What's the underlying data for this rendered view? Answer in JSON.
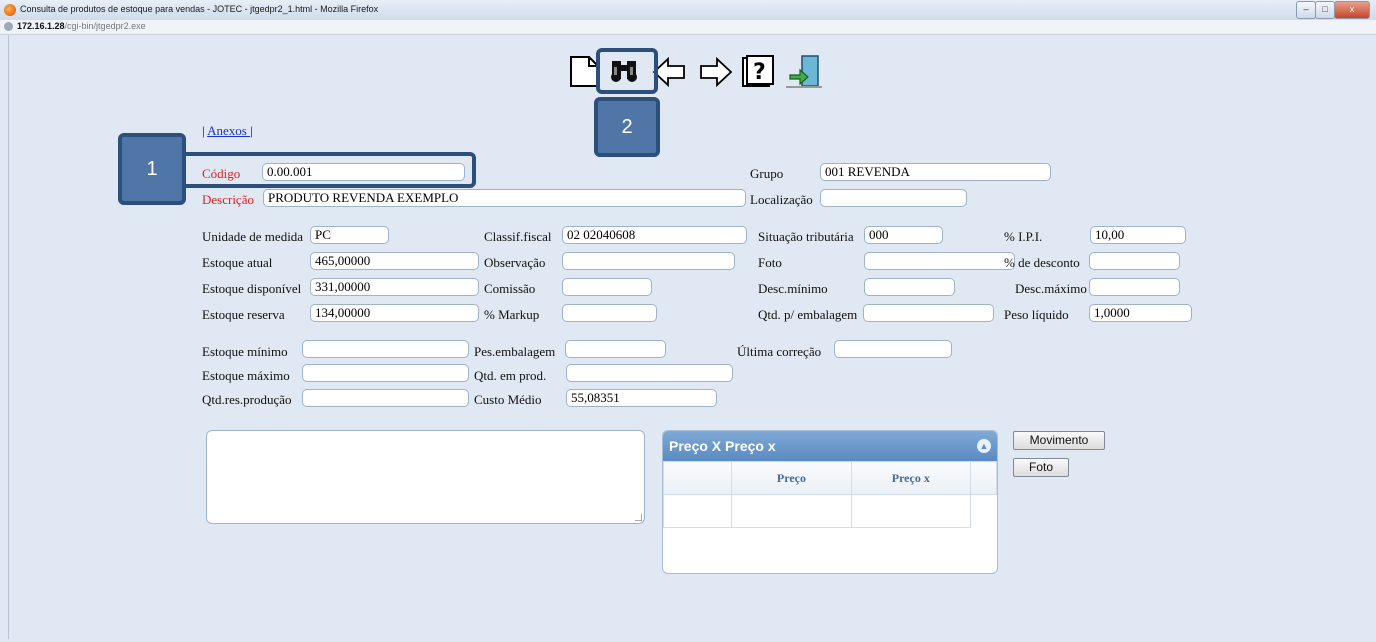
{
  "window": {
    "title": "Consulta de produtos de estoque para vendas - JOTEC - jtgedpr2_1.html - Mozilla Firefox",
    "url_host": "172.16.1.28",
    "url_path": "/cgi-bin/jtgedpr2.exe",
    "min_label": "–",
    "max_label": "□",
    "close_label": "x"
  },
  "toolbar": {
    "icons": [
      "new-document-icon",
      "search-binoculars-icon",
      "previous-arrow-icon",
      "next-arrow-icon",
      "help-icon",
      "exit-icon"
    ]
  },
  "callouts": {
    "one": "1",
    "two": "2"
  },
  "anexos": {
    "pre": "| ",
    "link": "Anexos ",
    "post": " |"
  },
  "fields": {
    "codigo": {
      "label": "Código",
      "value": "0.00.001"
    },
    "grupo": {
      "label": "Grupo",
      "value": "001 REVENDA"
    },
    "descricao": {
      "label": "Descrição",
      "value": "PRODUTO REVENDA EXEMPLO"
    },
    "localizacao": {
      "label": "Localização",
      "value": ""
    },
    "unidade": {
      "label": "Unidade de medida",
      "value": "PC"
    },
    "classif": {
      "label": "Classif.fiscal",
      "value": "02 02040608"
    },
    "situacao": {
      "label": "Situação tributária",
      "value": "000"
    },
    "ipi": {
      "label": "% I.P.I.",
      "value": "10,00"
    },
    "estoque_atual": {
      "label": "Estoque atual",
      "value": "465,00000"
    },
    "observacao": {
      "label": "Observação",
      "value": ""
    },
    "foto": {
      "label": "Foto",
      "value": ""
    },
    "desconto": {
      "label": "% de desconto",
      "value": ""
    },
    "estoque_disp": {
      "label": "Estoque disponível",
      "value": "331,00000"
    },
    "comissao": {
      "label": "Comissão",
      "value": ""
    },
    "desc_min": {
      "label": "Desc.mínimo",
      "value": ""
    },
    "desc_max": {
      "label": "Desc.máximo",
      "value": ""
    },
    "estoque_res": {
      "label": "Estoque reserva",
      "value": "134,00000"
    },
    "markup": {
      "label": "% Markup",
      "value": ""
    },
    "qtd_emb": {
      "label": "Qtd. p/ embalagem",
      "value": ""
    },
    "peso": {
      "label": "Peso líquido",
      "value": "1,0000"
    },
    "estoque_min": {
      "label": "Estoque mínimo",
      "value": ""
    },
    "pes_emb": {
      "label": "Pes.embalagem",
      "value": ""
    },
    "ultima": {
      "label": "Última correção",
      "value": ""
    },
    "estoque_max": {
      "label": "Estoque máximo",
      "value": ""
    },
    "qtd_prod": {
      "label": "Qtd. em prod.",
      "value": ""
    },
    "qtd_res_prod": {
      "label": "Qtd.res.produção",
      "value": ""
    },
    "custo": {
      "label": "Custo Médio",
      "value": "55,08351"
    }
  },
  "grid": {
    "caption": "Preço X Preço x",
    "toggle": "▲",
    "col1": "Preço",
    "col2": "Preço x"
  },
  "buttons": {
    "movimento": "Movimento",
    "foto": "Foto"
  }
}
